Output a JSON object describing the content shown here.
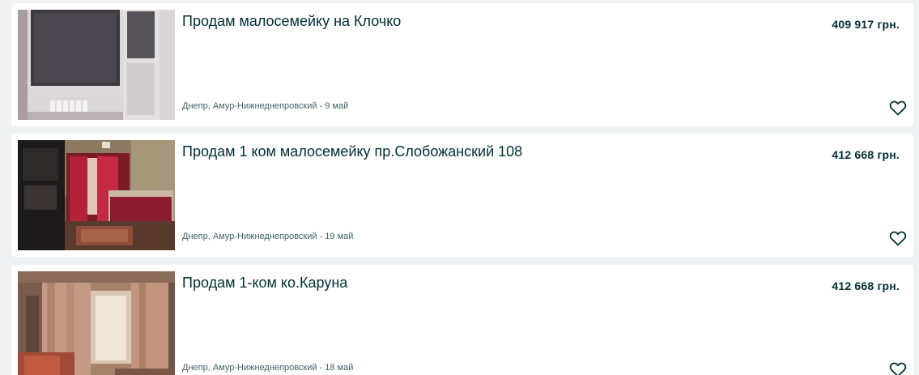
{
  "listings": [
    {
      "title": "Продам малосемейку на Клочко",
      "price": "409 917 грн.",
      "location_date": "Днепр, Амур-Нижнеднепровский - 9 май",
      "favorite_icon": "heart-outline-icon"
    },
    {
      "title": "Продам 1 ком малосемейку пр.Слобожанский 108",
      "price": "412 668 грн.",
      "location_date": "Днепр, Амур-Нижнеднепровский - 19 май",
      "favorite_icon": "heart-outline-icon"
    },
    {
      "title": "Продам 1-ком ко.Каруна",
      "price": "412 668 грн.",
      "location_date": "Днепр, Амур-Нижнеднепровский - 18 май",
      "favorite_icon": "heart-outline-icon"
    }
  ],
  "colors": {
    "page_background": "#eff2f2",
    "card_background": "#ffffff",
    "text_primary": "#002f34",
    "text_secondary": "#406367"
  }
}
